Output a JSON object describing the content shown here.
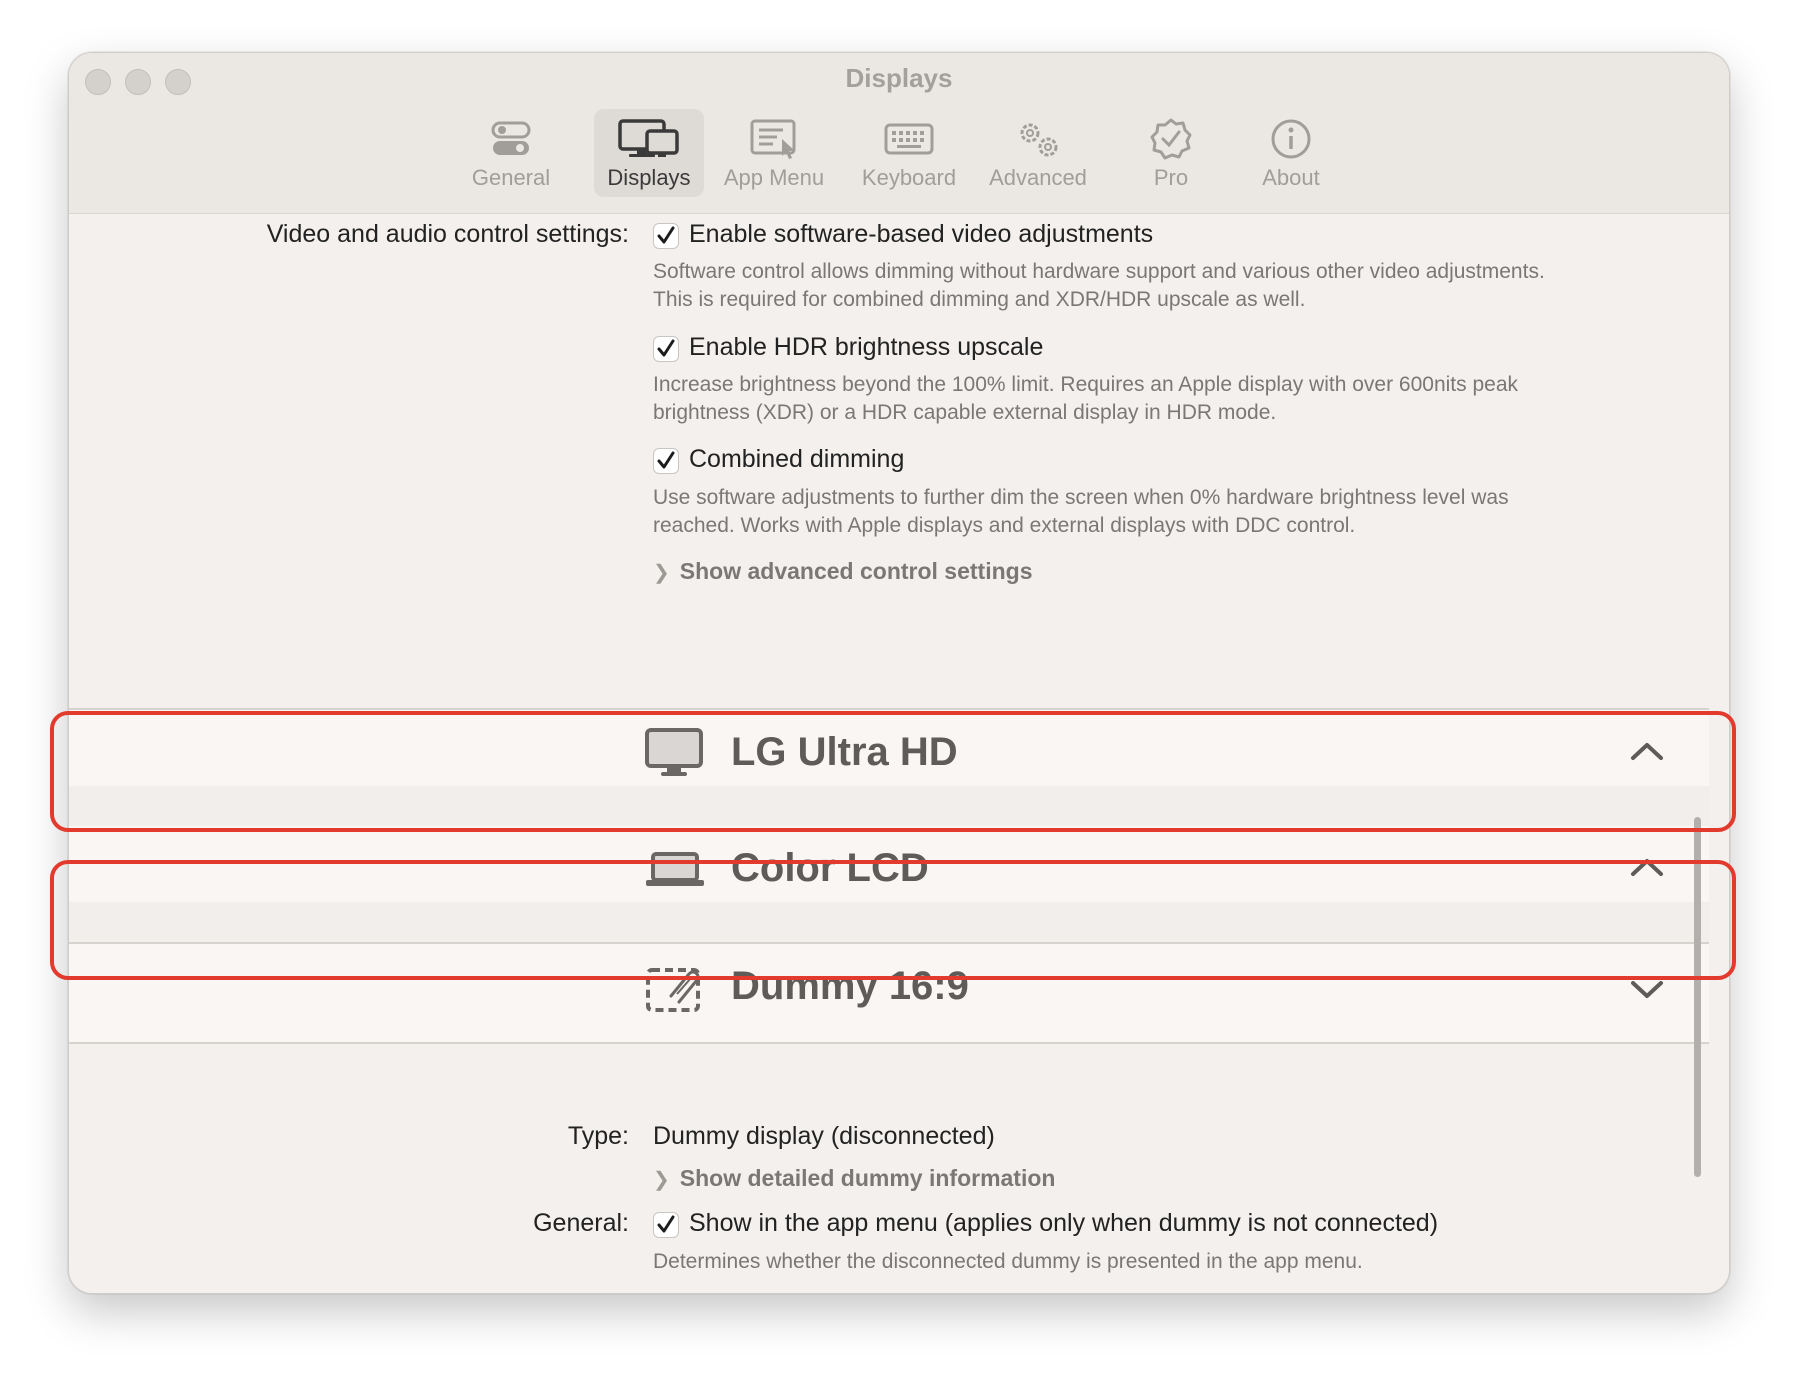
{
  "window": {
    "title": "Displays"
  },
  "toolbar": {
    "tabs": [
      {
        "label": "General",
        "icon": "toggles-icon",
        "active": false
      },
      {
        "label": "Displays",
        "icon": "displays-icon",
        "active": true
      },
      {
        "label": "App Menu",
        "icon": "app-menu-icon",
        "active": false
      },
      {
        "label": "Keyboard",
        "icon": "keyboard-icon",
        "active": false
      },
      {
        "label": "Advanced",
        "icon": "gears-icon",
        "active": false
      },
      {
        "label": "Pro",
        "icon": "checkmark-seal-icon",
        "active": false
      },
      {
        "label": "About",
        "icon": "info-icon",
        "active": false
      }
    ]
  },
  "video_audio": {
    "label": "Video and audio control settings:",
    "options": [
      {
        "label": "Enable software-based video adjustments",
        "checked": true,
        "description_line1": "Software control allows dimming without hardware support and  various other video adjustments.",
        "description_line2": "This is required for combined dimming and XDR/HDR upscale as well."
      },
      {
        "label": "Enable HDR brightness upscale",
        "checked": true,
        "description_line1": "Increase brightness beyond the 100% limit. Requires an Apple display with over 600nits peak",
        "description_line2": "brightness (XDR) or a HDR capable external display in HDR mode."
      },
      {
        "label": "Combined dimming",
        "checked": true,
        "description_line1": "Use software adjustments to further dim the screen when 0% hardware brightness level was",
        "description_line2": "reached. Works with Apple displays and external displays with DDC control."
      }
    ],
    "advanced_link": "Show advanced control settings"
  },
  "displays": [
    {
      "name": "LG Ultra HD",
      "icon": "monitor-icon",
      "expanded": true
    },
    {
      "name": "Color LCD",
      "icon": "laptop-icon",
      "expanded": true
    },
    {
      "name": "Dummy 16:9",
      "icon": "dummy-display-icon",
      "expanded": false
    }
  ],
  "dummy_details": {
    "type_label": "Type:",
    "type_value": "Dummy display (disconnected)",
    "details_link": "Show detailed dummy information",
    "general_label": "General:",
    "show_in_menu_label": "Show in the app menu (applies only when dummy is not connected)",
    "show_in_menu_checked": true,
    "show_in_menu_description": "Determines whether the disconnected dummy is presented in the app menu."
  },
  "colors": {
    "highlight": "#e23b2e",
    "window_background": "#f3f0ed",
    "active_tab": "#dedad6"
  },
  "scroll_position": 0.85
}
